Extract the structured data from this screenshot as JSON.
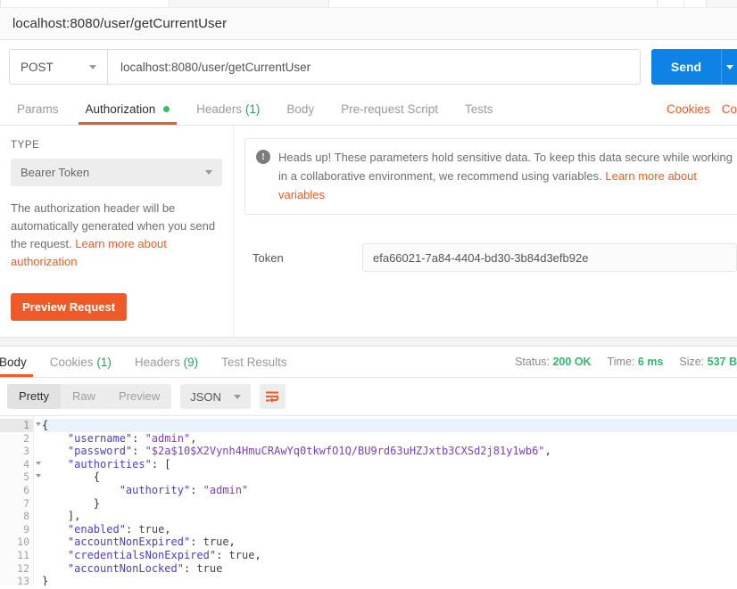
{
  "window": {
    "url_title": "localhost:8080/user/getCurrentUser"
  },
  "request": {
    "method": "POST",
    "url": "localhost:8080/user/getCurrentUser",
    "send_label": "Send"
  },
  "request_tabs": [
    {
      "label": "Params",
      "active": false,
      "badge": "",
      "dot": false
    },
    {
      "label": "Authorization",
      "active": true,
      "badge": "",
      "dot": true
    },
    {
      "label": "Headers",
      "active": false,
      "badge": "(1)",
      "dot": false
    },
    {
      "label": "Body",
      "active": false,
      "badge": "",
      "dot": false
    },
    {
      "label": "Pre-request Script",
      "active": false,
      "badge": "",
      "dot": false
    },
    {
      "label": "Tests",
      "active": false,
      "badge": "",
      "dot": false
    }
  ],
  "request_tab_links": [
    {
      "label": "Cookies"
    },
    {
      "label": "Co"
    }
  ],
  "authorization": {
    "type_label": "TYPE",
    "type_value": "Bearer Token",
    "description_text": "The authorization header will be automatically generated when you send the request. ",
    "description_link": "Learn more about authorization",
    "preview_button": "Preview Request",
    "heads_up_icon": "exclamation-icon",
    "heads_up_text": "Heads up! These parameters hold sensitive data. To keep this data secure while working in a collaborative environment, we recommend using variables. ",
    "heads_up_link": "Learn more about variables",
    "token_label": "Token",
    "token_value": "efa66021-7a84-4404-bd30-3b84d3efb92e"
  },
  "response_tabs": [
    {
      "label": "Body",
      "active": true,
      "badge": ""
    },
    {
      "label": "Cookies",
      "active": false,
      "badge": "(1)"
    },
    {
      "label": "Headers",
      "active": false,
      "badge": "(9)"
    },
    {
      "label": "Test Results",
      "active": false,
      "badge": ""
    }
  ],
  "response_stats": [
    {
      "label": "Status:",
      "value": "200 OK"
    },
    {
      "label": "Time:",
      "value": "6 ms"
    },
    {
      "label": "Size:",
      "value": "537 B"
    }
  ],
  "body_toolbar": {
    "views": [
      {
        "label": "Pretty",
        "active": true
      },
      {
        "label": "Raw",
        "active": false
      },
      {
        "label": "Preview",
        "active": false
      }
    ],
    "format": "JSON",
    "wrap_icon": "word-wrap-icon"
  },
  "response_body": {
    "lines": [
      {
        "n": "1",
        "fold": true,
        "text": "{"
      },
      {
        "n": "2",
        "fold": false,
        "text": "    \"username\": \"admin\","
      },
      {
        "n": "3",
        "fold": false,
        "text": "    \"password\": \"$2a$10$X2Vynh4HmuCRAwYq0tkwfO1Q/BU9rd63uHZJxtb3CXSd2j81y1wb6\","
      },
      {
        "n": "4",
        "fold": true,
        "text": "    \"authorities\": ["
      },
      {
        "n": "5",
        "fold": true,
        "text": "        {"
      },
      {
        "n": "6",
        "fold": false,
        "text": "            \"authority\": \"admin\""
      },
      {
        "n": "7",
        "fold": false,
        "text": "        }"
      },
      {
        "n": "8",
        "fold": false,
        "text": "    ],"
      },
      {
        "n": "9",
        "fold": false,
        "text": "    \"enabled\": true,"
      },
      {
        "n": "10",
        "fold": false,
        "text": "    \"accountNonExpired\": true,"
      },
      {
        "n": "11",
        "fold": false,
        "text": "    \"credentialsNonExpired\": true,"
      },
      {
        "n": "12",
        "fold": false,
        "text": "    \"accountNonLocked\": true"
      },
      {
        "n": "13",
        "fold": false,
        "text": "}"
      }
    ]
  },
  "colors": {
    "accent_orange": "#f05a28",
    "send_blue": "#0f82e6",
    "status_green": "#35b56e"
  }
}
